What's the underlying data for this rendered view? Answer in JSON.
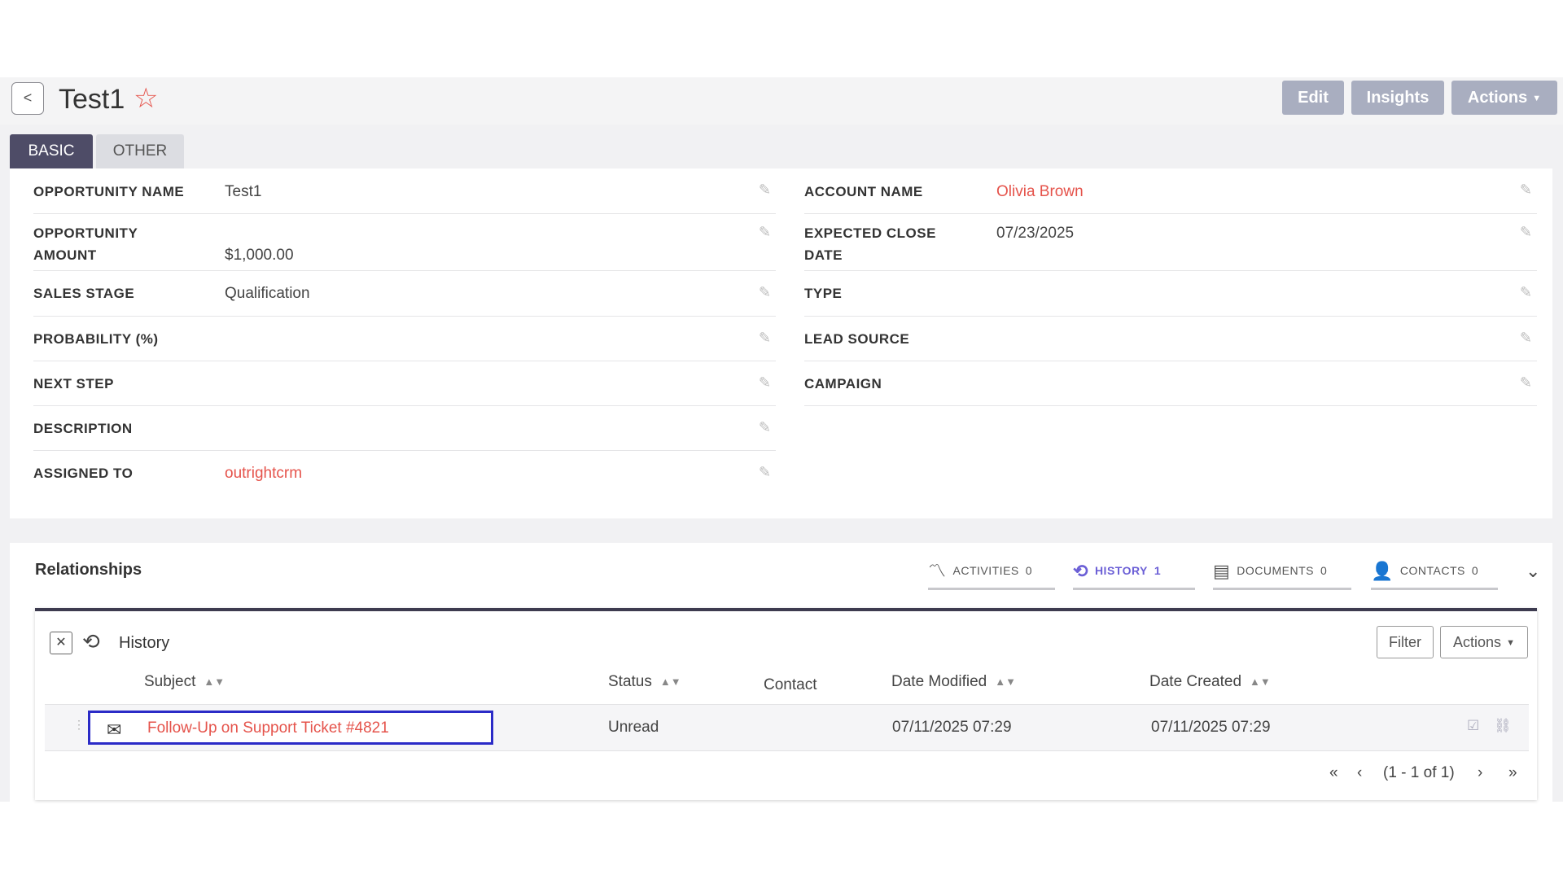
{
  "header": {
    "back": "<",
    "title": "Test1",
    "star": "☆",
    "buttons": {
      "edit": "Edit",
      "insights": "Insights",
      "actions": "Actions"
    }
  },
  "tabs": {
    "basic": "BASIC",
    "other": "OTHER"
  },
  "fields_left": [
    {
      "label": "OPPORTUNITY NAME",
      "value": "Test1"
    },
    {
      "label": "OPPORTUNITY",
      "label2": "AMOUNT",
      "value": "$1,000.00"
    },
    {
      "label": "SALES STAGE",
      "value": "Qualification"
    },
    {
      "label": "PROBABILITY (%)",
      "value": ""
    },
    {
      "label": "NEXT STEP",
      "value": ""
    },
    {
      "label": "DESCRIPTION",
      "value": ""
    },
    {
      "label": "ASSIGNED TO",
      "value": "outrightcrm"
    }
  ],
  "fields_right": [
    {
      "label": "ACCOUNT NAME",
      "value": "Olivia Brown"
    },
    {
      "label": "EXPECTED CLOSE",
      "label2": "DATE",
      "value": "07/23/2025"
    },
    {
      "label": "TYPE",
      "value": ""
    },
    {
      "label": "LEAD SOURCE",
      "value": ""
    },
    {
      "label": "CAMPAIGN",
      "value": ""
    }
  ],
  "relationships": {
    "title": "Relationships",
    "tabs": [
      {
        "label": "ACTIVITIES",
        "count": "0"
      },
      {
        "label": "HISTORY",
        "count": "1"
      },
      {
        "label": "DOCUMENTS",
        "count": "0"
      },
      {
        "label": "CONTACTS",
        "count": "0"
      }
    ]
  },
  "history": {
    "title": "History",
    "filter": "Filter",
    "actions": "Actions",
    "columns": {
      "subject": "Subject",
      "status": "Status",
      "contact": "Contact",
      "modified": "Date Modified",
      "created": "Date Created"
    },
    "rows": [
      {
        "subject": "Follow-Up on Support Ticket #4821",
        "status": "Unread",
        "contact": "",
        "modified": "07/11/2025 07:29",
        "created": "07/11/2025 07:29"
      }
    ],
    "pagination": {
      "first": "«",
      "prev": "‹",
      "info": "(1 - 1 of 1)",
      "next": "›",
      "last": "»"
    }
  },
  "colors": {
    "accent": "#4e4c67",
    "link": "#e5534b",
    "highlight": "#2b2bc7",
    "active_tab": "#6b5fd6"
  }
}
